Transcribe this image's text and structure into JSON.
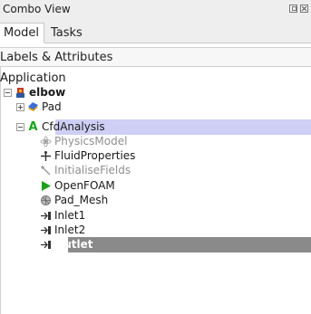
{
  "window": {
    "title": "Combo View"
  },
  "tabs": [
    {
      "label": "Model"
    },
    {
      "label": "Tasks"
    }
  ],
  "section": {
    "header": "Labels & Attributes"
  },
  "tree": {
    "root_label": "Application",
    "items": [
      {
        "label": "elbow",
        "icon": "document-icon",
        "expanded": true
      },
      {
        "label": "Pad",
        "icon": "pad-icon",
        "expanded": false
      },
      {
        "label": "CfdAnalysis",
        "icon": "analysis-icon",
        "expanded": true,
        "selected": true
      },
      {
        "label": "PhysicsModel",
        "icon": "physics-icon",
        "disabled": true
      },
      {
        "label": "FluidProperties",
        "icon": "fluid-icon"
      },
      {
        "label": "InitialiseFields",
        "icon": "initialise-icon",
        "disabled": true
      },
      {
        "label": "OpenFOAM",
        "icon": "solver-play-icon"
      },
      {
        "label": "Pad_Mesh",
        "icon": "mesh-icon"
      },
      {
        "label": "Inlet1",
        "icon": "boundary-icon"
      },
      {
        "label": "Inlet2",
        "icon": "boundary-icon"
      },
      {
        "label": "Outlet",
        "icon": "boundary-icon",
        "selected": true
      }
    ]
  },
  "colors": {
    "selection_light": "#cfcff5",
    "selection_dark": "#8a8a8a",
    "play_green": "#1aa31a"
  }
}
